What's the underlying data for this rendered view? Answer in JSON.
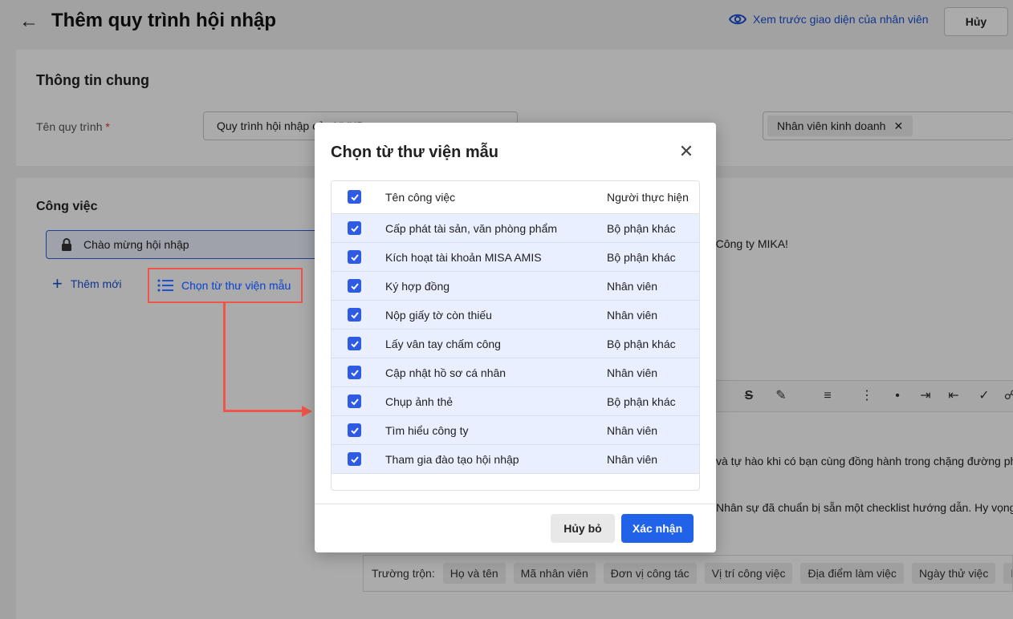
{
  "header": {
    "title": "Thêm quy trình hội nhập",
    "preview_label": "Xem trước giao diện của nhân viên",
    "cancel_label": "Hủy"
  },
  "general": {
    "title": "Thông tin chung",
    "name_label": "Tên quy trình",
    "name_value": "Quy trình hội nhập của NVKD",
    "position_chip": "Nhân viên kinh doanh"
  },
  "tasks": {
    "title": "Công việc",
    "first_item": "Chào mừng hội nhập",
    "add_new": "Thêm mới",
    "choose_library": "Chọn từ thư viện mẫu"
  },
  "editor": {
    "greeting_fragment": "a Công ty MIKA!",
    "line1": "và tự hào khi có bạn cùng đồng hành trong chặng đường phá",
    "line2": "Nhân sự đã chuẩn bị sẵn một checklist hướng dẫn. Hy vọng",
    "merge_label": "Trường trộn:",
    "merge_fields": [
      "Họ và tên",
      "Mã nhân viên",
      "Đơn vị công tác",
      "Vị trí công việc",
      "Địa điểm làm việc",
      "Ngày thử việc",
      "Ngày c"
    ]
  },
  "modal": {
    "title": "Chọn từ thư viện mẫu",
    "col_task": "Tên công việc",
    "col_owner": "Người thực hiện",
    "rows": [
      {
        "task": "Cấp phát tài sản, văn phòng phẩm",
        "owner": "Bộ phận khác"
      },
      {
        "task": "Kích hoạt tài khoản MISA AMIS",
        "owner": "Bộ phận khác"
      },
      {
        "task": "Ký hợp đồng",
        "owner": "Nhân viên"
      },
      {
        "task": "Nộp giấy tờ còn thiếu",
        "owner": "Nhân viên"
      },
      {
        "task": "Lấy vân tay chấm công",
        "owner": "Bộ phận khác"
      },
      {
        "task": "Cập nhật hồ sơ cá nhân",
        "owner": "Nhân viên"
      },
      {
        "task": "Chụp ảnh thẻ",
        "owner": "Bộ phận khác"
      },
      {
        "task": "Tìm hiểu công ty",
        "owner": "Nhân viên"
      },
      {
        "task": "Tham gia đào tạo hội nhập",
        "owner": "Nhân viên"
      }
    ],
    "cancel_label": "Hủy bỏ",
    "confirm_label": "Xác nhận"
  },
  "colors": {
    "primary": "#2163e8",
    "annotation": "#f0554a",
    "row_selected": "#e9efff"
  }
}
